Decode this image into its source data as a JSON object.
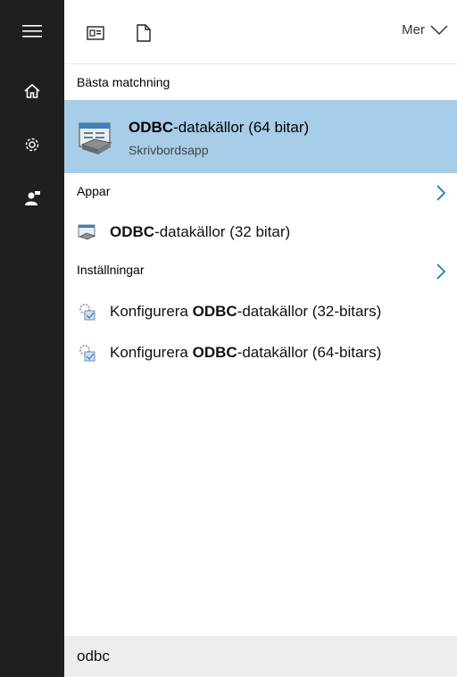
{
  "rail": {
    "icons": [
      "hamburger-icon",
      "home-icon",
      "settings-gear-icon",
      "user-feedback-icon"
    ]
  },
  "topbar": {
    "more_label": "Mer",
    "icons": [
      "document-list-icon",
      "blank-document-icon",
      "chevron-down-icon"
    ]
  },
  "best_match": {
    "heading": "Bästa matchning",
    "title_bold": "ODBC",
    "title_rest": "-datakällor (64 bitar)",
    "subtitle": "Skrivbordsapp",
    "icon": "odbc-app-icon"
  },
  "apps": {
    "heading": "Appar",
    "items": [
      {
        "bold": "ODBC",
        "rest": "-datakällor (32 bitar)",
        "icon": "odbc-app-icon"
      }
    ]
  },
  "settings": {
    "heading": "Inställningar",
    "items": [
      {
        "pre": "Konfigurera ",
        "bold": "ODBC",
        "rest": "-datakällor (32-bitars)",
        "icon": "settings-admin-icon"
      },
      {
        "pre": "Konfigurera ",
        "bold": "ODBC",
        "rest": "-datakällor (64-bitars)",
        "icon": "settings-admin-icon"
      }
    ]
  },
  "search": {
    "value": "odbc"
  },
  "colors": {
    "rail_bg": "#1f1f1f",
    "highlight": "#a8cde8",
    "accent": "#0078d7",
    "search_bg": "#ededed"
  }
}
